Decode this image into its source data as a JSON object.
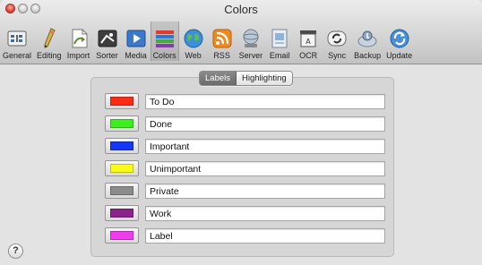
{
  "window": {
    "title": "Colors"
  },
  "toolbar": {
    "items": [
      {
        "label": "General",
        "icon": "general-icon"
      },
      {
        "label": "Editing",
        "icon": "pencil-icon"
      },
      {
        "label": "Import",
        "icon": "import-icon"
      },
      {
        "label": "Sorter",
        "icon": "sorter-icon"
      },
      {
        "label": "Media",
        "icon": "media-icon"
      },
      {
        "label": "Colors",
        "icon": "colors-icon",
        "selected": true
      },
      {
        "label": "Web",
        "icon": "globe-icon"
      },
      {
        "label": "RSS",
        "icon": "rss-icon"
      },
      {
        "label": "Server",
        "icon": "server-icon"
      },
      {
        "label": "Email",
        "icon": "email-icon"
      },
      {
        "label": "OCR",
        "icon": "ocr-icon"
      },
      {
        "label": "Sync",
        "icon": "sync-icon"
      },
      {
        "label": "Backup",
        "icon": "backup-icon"
      },
      {
        "label": "Update",
        "icon": "update-icon"
      }
    ]
  },
  "segmented": {
    "labels_tab": "Labels",
    "highlighting_tab": "Highlighting",
    "selected": "Labels"
  },
  "labels": [
    {
      "name": "To Do",
      "color": "#ff2a13"
    },
    {
      "name": "Done",
      "color": "#3cf01d"
    },
    {
      "name": "Important",
      "color": "#1436f7"
    },
    {
      "name": "Unimportant",
      "color": "#fbfb19"
    },
    {
      "name": "Private",
      "color": "#8c8c8c"
    },
    {
      "name": "Work",
      "color": "#8b2388"
    },
    {
      "name": "Label",
      "color": "#f03cf0"
    }
  ],
  "help": {
    "label": "?"
  }
}
